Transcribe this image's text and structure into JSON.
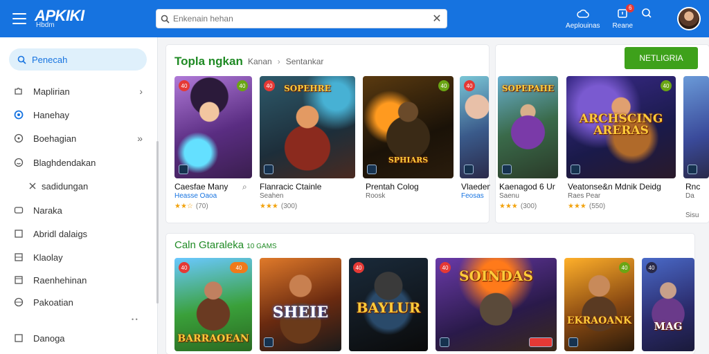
{
  "app": {
    "logo": "APKIKI",
    "logo_sub": "Hbdm"
  },
  "search": {
    "placeholder": "Enkenain hehan"
  },
  "topbar": {
    "btn1_label": "Aeplouinas",
    "btn2_label": "Reane",
    "badge": "6"
  },
  "sidebar": {
    "search_label": "Penecah",
    "items": [
      {
        "label": "Maplirian",
        "icon": "puzzle-icon"
      },
      {
        "label": "Hanehay",
        "icon": "circle-icon"
      },
      {
        "label": "Boehagian",
        "icon": "clock-icon"
      },
      {
        "label": "Blaghdendakan",
        "icon": "smile-icon"
      },
      {
        "label": "sadidungan",
        "icon": "tool-icon"
      },
      {
        "label": "Naraka",
        "icon": "gamepad-icon"
      },
      {
        "label": "Abridl dalaigs",
        "icon": "square-icon"
      },
      {
        "label": "Klaolay",
        "icon": "square-icon"
      },
      {
        "label": "Raenhehinan",
        "icon": "square-icon"
      },
      {
        "label": "Pakoatian",
        "icon": "globe-icon"
      },
      {
        "label": "Danoga",
        "icon": "square-icon"
      }
    ]
  },
  "top_section": {
    "title": "Topla ngkan",
    "crumb1": "Kanan",
    "crumb2": "Sentankar",
    "cta": "NETLIGRIA",
    "games": [
      {
        "title": "Caesfae Many",
        "subtitle": "Heasse Oaoa",
        "rating_count": "(70)"
      },
      {
        "title": "Flanracic Ctainle",
        "subtitle": "Seahen",
        "rating_count": "(300)"
      },
      {
        "title": "Prentah Colog",
        "subtitle": "Roosk",
        "rating_count": ""
      },
      {
        "title": "Vlaeden",
        "subtitle": "Feosas",
        "rating_count": ""
      },
      {
        "title": "Kaenagod 6 Ur",
        "subtitle": "Saenu",
        "rating_count": "(300)"
      },
      {
        "title": "Veatonse&n Mdnik Deidg",
        "subtitle": "Raes Pear",
        "rating_count": "(550)"
      },
      {
        "title": "Rnc",
        "subtitle": "Da",
        "rating_count": "Sisu"
      }
    ],
    "art_texts": [
      "",
      "SOPEHRE",
      "SPHIARS",
      "",
      "SOPEPAHE",
      "ARCHSCING ARERAS",
      ""
    ]
  },
  "bottom_section": {
    "title": "Caln Gtaraleka",
    "count": "10 GAMS",
    "art_texts": [
      "BARRAOEAN",
      "SHEIE",
      "BAYLUR",
      "SOINDAS",
      "EKRAOANK",
      "MAG"
    ]
  },
  "colors": {
    "topbar": "#1673e0",
    "accent_green": "#3ea11b",
    "title_green": "#1f8a24"
  }
}
